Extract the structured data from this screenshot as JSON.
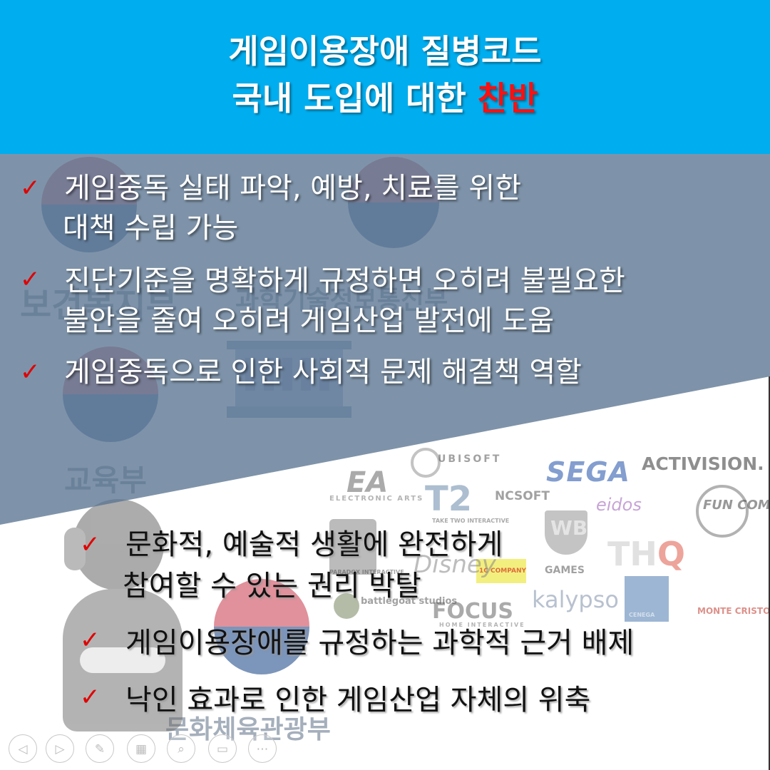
{
  "header": {
    "line1": "게임이용장애 질병코드",
    "line2_main": "국내 도입에 대한 ",
    "line2_accent": "찬반",
    "accent_color": "#ff1010",
    "background_color": "#00aeef"
  },
  "pros": [
    {
      "line1": "게임중독 실태 파악, 예방, 치료를 위한",
      "line2": "대책 수립 가능"
    },
    {
      "line1": "진단기준을 명확하게 규정하면 오히려 불필요한",
      "line2": "불안을 줄여 오히려 게임산업 발전에 도움"
    },
    {
      "line1": "게임중독으로 인한 사회적 문제 해결책 역할"
    }
  ],
  "cons": [
    {
      "line1": "문화적, 예술적 생활에 완전하게",
      "line2": "참여할 수 있는 권리 박탈"
    },
    {
      "line1": "게임이용장애를 규정하는 과학적 근거 배제"
    },
    {
      "line1": "낙인 효과로 인한 게임산업 자체의 위축"
    }
  ],
  "check_icon": "✓",
  "check_color": "#e00000",
  "watermark": {
    "ministry_health": "보건복지부",
    "ministry_science": "과학기술정보통신부",
    "ministry_education": "교육부",
    "ministry_culture": "문화체육관광부"
  },
  "logos": {
    "ubisoft": "UBISOFT",
    "sega": "SEGA",
    "activision": "ACTIVISION.",
    "ea": "EA",
    "ea_sub": "ELECTRONIC ARTS",
    "t2": "T2",
    "t2_sub": "TAKE TWO INTERACTIVE",
    "ncsoft": "NCSOFT",
    "eidos": "eidos",
    "funcom": "FUN COM",
    "wb": "WB",
    "wb_sub": "GAMES",
    "thq_main": "TH",
    "thq_accent": "Q",
    "onec": "1C COMPANY",
    "pi": "PARADOX INTERACTIVE",
    "disney": "Disney",
    "kalypso": "kalypso",
    "cenega": "CENEGA",
    "monte": "MONTE CRISTO",
    "focus": "FOCUS",
    "focus_sub": "HOME INTERACTIVE",
    "battle": "battlegoat studios"
  },
  "nav_icons": [
    {
      "name": "prev-icon",
      "glyph": "◁"
    },
    {
      "name": "next-icon",
      "glyph": "▷"
    },
    {
      "name": "pen-icon",
      "glyph": "✎"
    },
    {
      "name": "slides-icon",
      "glyph": "▦"
    },
    {
      "name": "zoom-icon",
      "glyph": "⌕"
    },
    {
      "name": "subtitle-icon",
      "glyph": "▭"
    },
    {
      "name": "more-icon",
      "glyph": "⋯"
    }
  ]
}
